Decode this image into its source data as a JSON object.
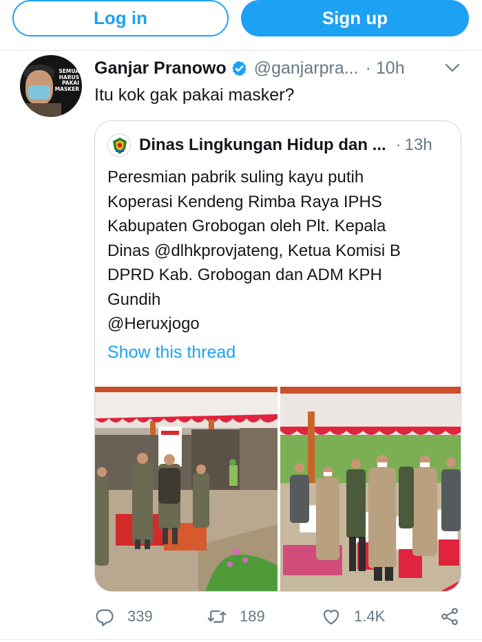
{
  "topbar": {
    "login_label": "Log in",
    "signup_label": "Sign up"
  },
  "tweet": {
    "author_name": "Ganjar Pranowo",
    "author_handle": "@ganjarpra...",
    "time": "10h",
    "text": "Itu kok gak pakai masker?",
    "avatar_text": "SEMUA HARUS PAKAI MASKER"
  },
  "quoted": {
    "author_name": "Dinas Lingkungan Hidup dan ...",
    "time": "13h",
    "lines": [
      "Peresmian pabrik suling kayu putih",
      "Koperasi Kendeng Rimba Raya IPHS",
      "Kabupaten Grobogan oleh Plt. Kepala",
      "Dinas @dlhkprovjateng, Ketua Komisi B",
      "DPRD Kab. Grobogan dan ADM KPH",
      "Gundih",
      "@Heruxjogo"
    ],
    "show_thread": "Show this thread"
  },
  "actions": {
    "replies": "339",
    "retweets": "189",
    "likes": "1.4K"
  },
  "colors": {
    "accent": "#1da1f2",
    "text": "#14171a",
    "muted": "#657786",
    "border": "#ccd6dd"
  },
  "icons": [
    "verified-badge-icon",
    "chevron-down-icon",
    "reply-icon",
    "retweet-icon",
    "like-icon",
    "share-icon"
  ]
}
